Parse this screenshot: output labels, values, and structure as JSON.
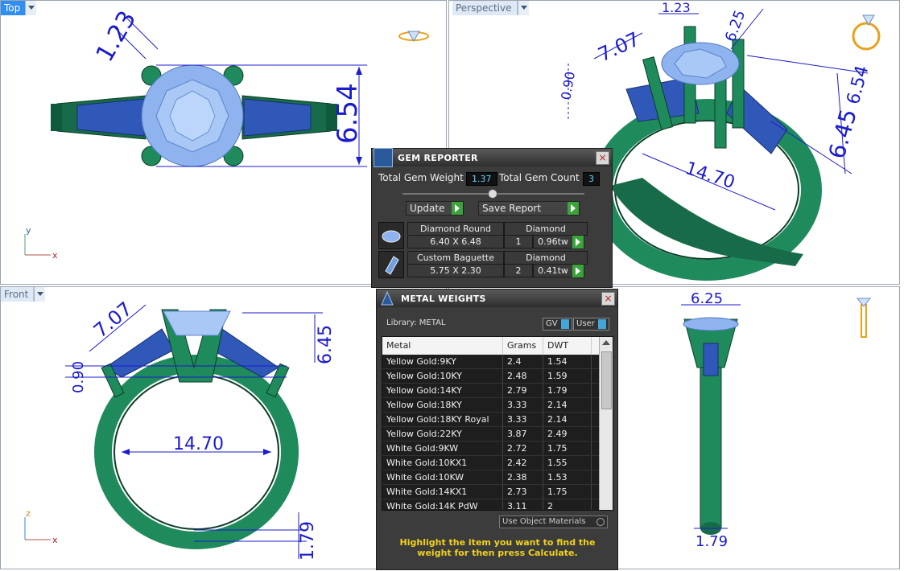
{
  "viewports": {
    "top": {
      "name": "Top",
      "active": true,
      "axis_y": "y",
      "axis_x": "x",
      "dims": {
        "prong": "1.23",
        "height": "6.54"
      }
    },
    "perspective": {
      "name": "Perspective",
      "dims": {
        "a": "1.23",
        "b": "6.25",
        "c": "7.07",
        "d": "0.90",
        "e": "6.54",
        "f": "6.45",
        "g": "14.70"
      }
    },
    "front": {
      "name": "Front",
      "axis_z": "z",
      "axis_x": "x",
      "dims": {
        "a": "7.07",
        "b": "6.45",
        "c": "0.90",
        "d": "14.70",
        "e": "1.79"
      }
    },
    "right": {
      "dims": {
        "top": "6.25",
        "bottom": "1.79"
      }
    }
  },
  "gem_reporter": {
    "title": "GEM REPORTER",
    "total_weight_label": "Total Gem Weight",
    "total_weight": "1.37",
    "total_count_label": "Total Gem Count",
    "total_count": "3",
    "update_label": "Update",
    "save_label": "Save Report",
    "gems": [
      {
        "name": "Diamond Round",
        "type": "Diamond",
        "size": "6.40 X 6.48",
        "qty": "1",
        "weight": "0.96tw"
      },
      {
        "name": "Custom Baguette",
        "type": "Diamond",
        "size": "5.75 X 2.30",
        "qty": "2",
        "weight": "0.41tw"
      }
    ]
  },
  "metal_weights": {
    "title": "METAL WEIGHTS",
    "library": "Library: METAL",
    "gv": "GV",
    "user": "User",
    "headers": [
      "Metal",
      "Grams",
      "DWT"
    ],
    "rows": [
      [
        "Yellow Gold:9KY",
        "2.4",
        "1.54"
      ],
      [
        "Yellow Gold:10KY",
        "2.48",
        "1.59"
      ],
      [
        "Yellow Gold:14KY",
        "2.79",
        "1.79"
      ],
      [
        "Yellow Gold:18KY",
        "3.33",
        "2.14"
      ],
      [
        "Yellow Gold:18KY Royal",
        "3.33",
        "2.14"
      ],
      [
        "Yellow Gold:22KY",
        "3.87",
        "2.49"
      ],
      [
        "White Gold:9KW",
        "2.72",
        "1.75"
      ],
      [
        "White Gold:10KX1",
        "2.42",
        "1.55"
      ],
      [
        "White Gold:10KW",
        "2.38",
        "1.53"
      ],
      [
        "White Gold:14KX1",
        "2.73",
        "1.75"
      ],
      [
        "White Gold:14K PdW",
        "3.11",
        "2"
      ]
    ],
    "use_object_materials": "Use Object Materials",
    "hint": "Highlight the item you want to find the weight for then press Calculate."
  },
  "colors": {
    "metal": "#1f8a5c",
    "gem": "#6f9fe0",
    "dim": "#1b1bcc",
    "hint": "#f2d21b"
  }
}
